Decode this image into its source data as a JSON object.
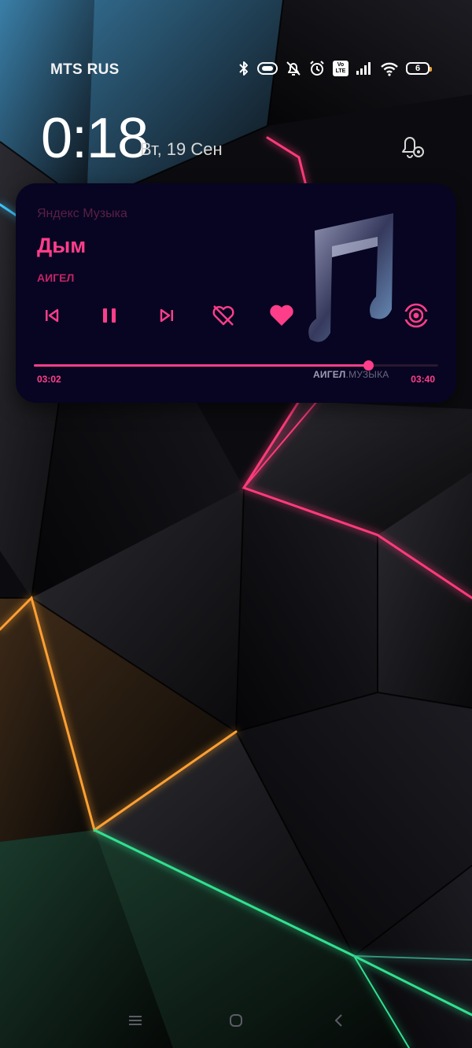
{
  "status_bar": {
    "carrier": "MTS RUS",
    "battery_level": "6",
    "icons": [
      "bluetooth-icon",
      "headset-icon",
      "mute-bell-icon",
      "alarm-icon",
      "volte-icon",
      "signal-icon",
      "wifi-icon",
      "battery-icon"
    ],
    "volte_top": "Vo",
    "volte_bottom": "LTE"
  },
  "lockscreen": {
    "time": "0:18",
    "date": "Вт, 19 Сен"
  },
  "music_widget": {
    "app_name": "Яндекс Музыка",
    "title": "Дым",
    "artist": "АИГЕЛ",
    "elapsed": "03:02",
    "total": "03:40",
    "progress_fraction": 0.827,
    "art_caption_artist": "АИГЕЛ",
    "art_caption_suffix": ".МУЗЫКА",
    "controls": [
      "previous-icon",
      "pause-icon",
      "next-icon",
      "dislike-icon",
      "like-icon",
      "cast-icon"
    ]
  },
  "colors": {
    "accent": "#ff3e8a",
    "widget_bg": "#070522",
    "app_name": "#5a1f45"
  },
  "nav_bar": {
    "buttons": [
      "menu-icon",
      "home-icon",
      "back-icon"
    ]
  }
}
